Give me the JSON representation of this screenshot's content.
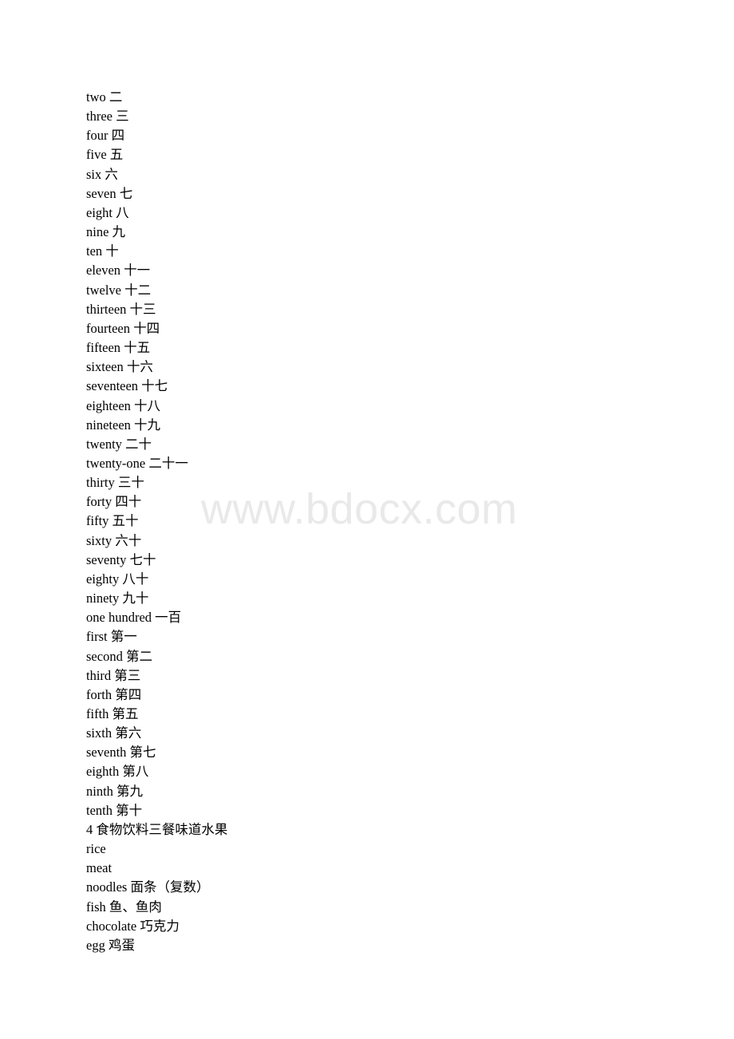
{
  "document": {
    "watermark": "www.bdocx.com",
    "lines": [
      "two 二",
      "three 三",
      "four 四",
      "five 五",
      "six 六",
      "seven 七",
      "eight 八",
      "nine 九",
      "ten 十",
      "eleven 十一",
      "twelve 十二",
      "thirteen 十三",
      "fourteen 十四",
      "fifteen 十五",
      "sixteen 十六",
      "seventeen 十七",
      "eighteen 十八",
      "nineteen 十九",
      "twenty 二十",
      "twenty-one 二十一",
      "thirty 三十",
      "forty 四十",
      "fifty 五十",
      "sixty 六十",
      "seventy 七十",
      "eighty 八十",
      "ninety 九十",
      "one hundred 一百",
      "first 第一",
      "second 第二",
      "third 第三",
      "forth 第四",
      "fifth 第五",
      "sixth 第六",
      "seventh 第七",
      "eighth 第八",
      "ninth 第九",
      "tenth 第十",
      "4 食物饮料三餐味道水果",
      "rice",
      "meat",
      "noodles 面条（复数）",
      "fish 鱼、鱼肉",
      "chocolate 巧克力",
      "egg 鸡蛋"
    ]
  }
}
